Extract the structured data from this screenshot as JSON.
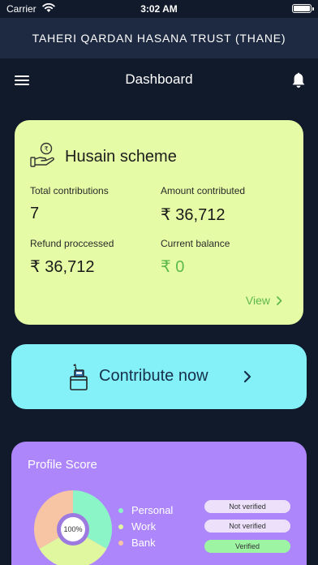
{
  "status_bar": {
    "carrier": "Carrier",
    "time": "3:02 AM"
  },
  "header": {
    "title": "TAHERI QARDAN HASANA TRUST (THANE)"
  },
  "nav": {
    "title": "Dashboard"
  },
  "scheme": {
    "title": "Husain scheme",
    "total_contributions_label": "Total contributions",
    "total_contributions_value": "7",
    "amount_contributed_label": "Amount contributed",
    "amount_contributed_value": "₹ 36,712",
    "refund_label": "Refund proccessed",
    "refund_value": "₹ 36,712",
    "balance_label": "Current balance",
    "balance_value": "₹ 0",
    "view_label": "View"
  },
  "contribute": {
    "label": "Contribute now"
  },
  "profile": {
    "title": "Profile Score",
    "center_label": "100%",
    "legend": [
      {
        "label": "Personal",
        "color": "#8cf5c8"
      },
      {
        "label": "Work",
        "color": "#e0f7a0"
      },
      {
        "label": "Bank",
        "color": "#f7c5a3"
      }
    ],
    "badges": [
      {
        "label": "Not verified",
        "color": "#ece0fb"
      },
      {
        "label": "Not verified",
        "color": "#ece0fb"
      },
      {
        "label": "Verified",
        "color": "#9df5a3"
      }
    ],
    "pie_colors": [
      "#8cf5c8",
      "#e0f7a0",
      "#f7c5a3"
    ]
  }
}
